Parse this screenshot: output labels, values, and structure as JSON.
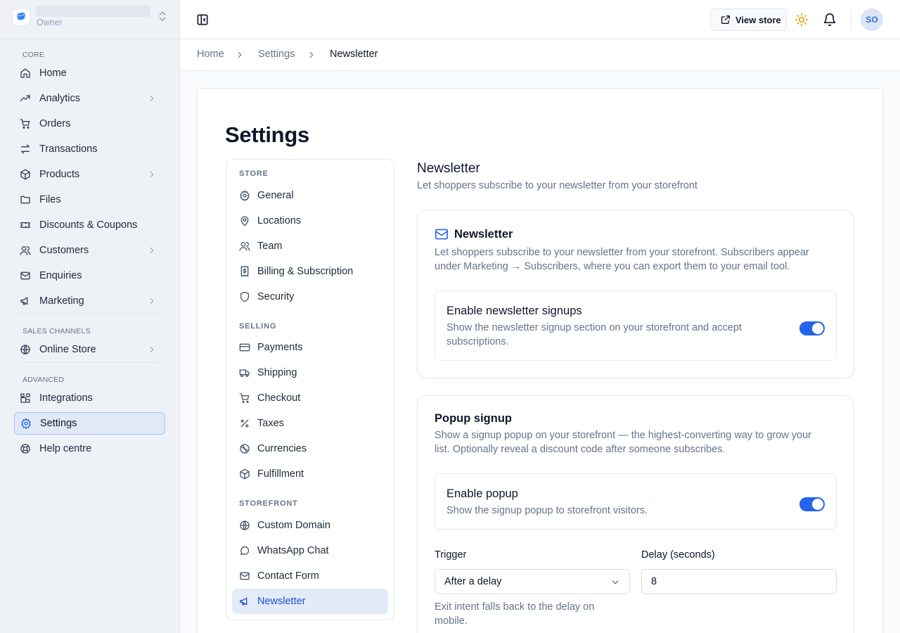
{
  "workspace": {
    "role": "Owner"
  },
  "sidebar": {
    "sections": {
      "core": "CORE",
      "sales": "SALES CHANNELS",
      "advanced": "ADVANCED"
    },
    "items": [
      {
        "label": "Home",
        "icon": "home-icon"
      },
      {
        "label": "Analytics",
        "icon": "trend-icon"
      },
      {
        "label": "Orders",
        "icon": "cart-icon"
      },
      {
        "label": "Transactions",
        "icon": "transfer-icon"
      },
      {
        "label": "Products",
        "icon": "box-icon"
      },
      {
        "label": "Files",
        "icon": "folder-icon"
      },
      {
        "label": "Discounts & Coupons",
        "icon": "ticket-icon"
      },
      {
        "label": "Customers",
        "icon": "users-icon"
      },
      {
        "label": "Enquiries",
        "icon": "mail-icon"
      },
      {
        "label": "Marketing",
        "icon": "megaphone-icon"
      },
      {
        "label": "Online Store",
        "icon": "globe-icon"
      },
      {
        "label": "Integrations",
        "icon": "blocks-icon"
      },
      {
        "label": "Settings",
        "icon": "gear-icon"
      },
      {
        "label": "Help centre",
        "icon": "lifebuoy-icon"
      }
    ]
  },
  "topbar": {
    "view_store": "View store",
    "avatar": "SO"
  },
  "breadcrumb": [
    "Home",
    "Settings",
    "Newsletter"
  ],
  "page": {
    "title": "Settings"
  },
  "settings_nav": {
    "sections": {
      "store": "STORE",
      "selling": "SELLING",
      "storefront": "STOREFRONT"
    },
    "items": [
      "General",
      "Locations",
      "Team",
      "Billing & Subscription",
      "Security",
      "Payments",
      "Shipping",
      "Checkout",
      "Taxes",
      "Currencies",
      "Fulfillment",
      "Custom Domain",
      "WhatsApp Chat",
      "Contact Form",
      "Newsletter"
    ]
  },
  "section": {
    "title": "Newsletter",
    "desc": "Let shoppers subscribe to your newsletter from your storefront"
  },
  "newsletter_card": {
    "title": "Newsletter",
    "desc_line1": "Let shoppers subscribe to your newsletter from your storefront. Subscribers appear",
    "desc_line2": "under Marketing → Subscribers, where you can export them to your email tool.",
    "toggle_title": "Enable newsletter signups",
    "toggle_desc_line1": "Show the newsletter signup section on your storefront and accept",
    "toggle_desc_line2": "subscriptions.",
    "enabled": true
  },
  "popup_card": {
    "title": "Popup signup",
    "desc_line1": "Show a signup popup on your storefront — the highest-converting way to grow your",
    "desc_line2": "list. Optionally reveal a discount code after someone subscribes.",
    "toggle_title": "Enable popup",
    "toggle_desc": "Show the signup popup to storefront visitors.",
    "enabled": true,
    "trigger_label": "Trigger",
    "trigger_value": "After a delay",
    "delay_label": "Delay (seconds)",
    "delay_value": "8",
    "hint_line1": "Exit intent falls back to the delay on",
    "hint_line2": "mobile."
  },
  "colors": {
    "accent": "#2563eb",
    "active_bg": "#e3ebf8",
    "sidebar_bg": "#eef1f6"
  }
}
